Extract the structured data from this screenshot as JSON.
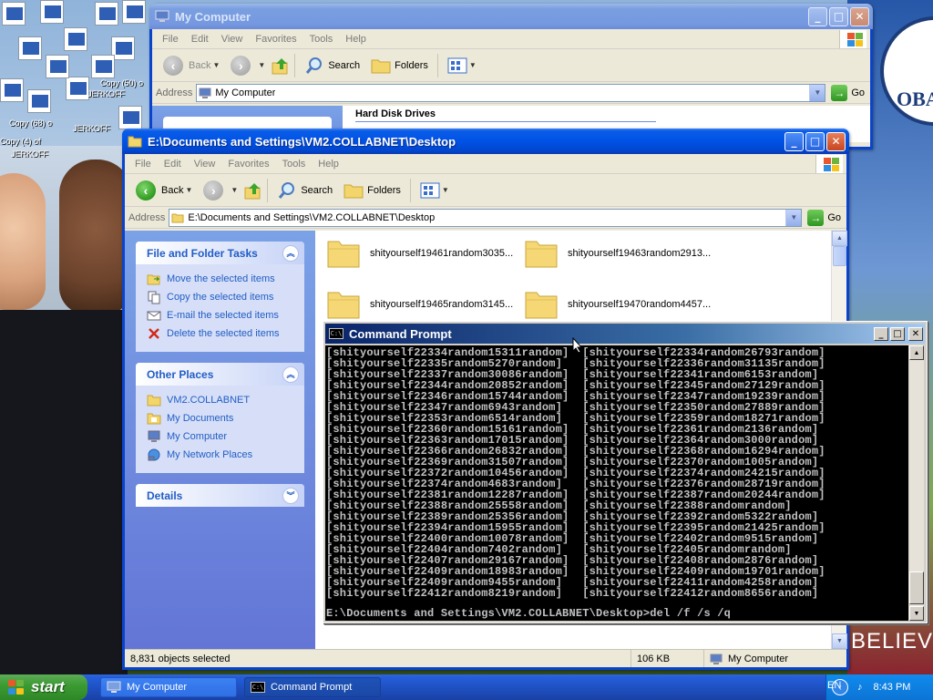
{
  "desktop": {
    "icon_labels": [
      "Copy (50) o",
      "Copy (4) of",
      "JERKOFF",
      "JERKOFF",
      "Copy (68) o",
      "JERKOFF"
    ],
    "wallpaper_text": "BELIEVE",
    "logo_text": "OBA"
  },
  "back_window": {
    "title": "My Computer",
    "menu": [
      "File",
      "Edit",
      "View",
      "Favorites",
      "Tools",
      "Help"
    ],
    "toolbar": {
      "back": "Back",
      "search": "Search",
      "folders": "Folders"
    },
    "address_label": "Address",
    "address_value": "My Computer",
    "go_label": "Go",
    "section_header": "Hard Disk Drives"
  },
  "explorer": {
    "title": "E:\\Documents and Settings\\VM2.COLLABNET\\Desktop",
    "menu": [
      "File",
      "Edit",
      "View",
      "Favorites",
      "Tools",
      "Help"
    ],
    "toolbar": {
      "back": "Back",
      "search": "Search",
      "folders": "Folders"
    },
    "address_label": "Address",
    "address_value": "E:\\Documents and Settings\\VM2.COLLABNET\\Desktop",
    "go_label": "Go",
    "file_folder_tasks": {
      "header": "File and Folder Tasks",
      "items": [
        "Move the selected items",
        "Copy the selected items",
        "E-mail the selected items",
        "Delete the selected items"
      ]
    },
    "other_places": {
      "header": "Other Places",
      "items": [
        "VM2.COLLABNET",
        "My Documents",
        "My Computer",
        "My Network Places"
      ]
    },
    "details": {
      "header": "Details"
    },
    "folders": [
      "shityourself19461random3035...",
      "shityourself19463random2913...",
      "shityourself19465random3145...",
      "shityourself19470random4457..."
    ],
    "status": {
      "objects": "8,831 objects selected",
      "size": "106 KB",
      "location": "My Computer"
    }
  },
  "cmd": {
    "title": "Command Prompt",
    "lines": [
      "[shityourself22334random15311random]  [shityourself22334random26793random]",
      "[shityourself22335random5270random]   [shityourself22336random31135random]",
      "[shityourself22337random30086random]  [shityourself22341random6153random]",
      "[shityourself22344random20852random]  [shityourself22345random27129random]",
      "[shityourself22346random15744random]  [shityourself22347random19239random]",
      "[shityourself22347random6943random]   [shityourself22350random27889random]",
      "[shityourself22353random6514random]   [shityourself22359random18271random]",
      "[shityourself22360random15161random]  [shityourself22361random2136random]",
      "[shityourself22363random17015random]  [shityourself22364random3000random]",
      "[shityourself22366random26832random]  [shityourself22368random16294random]",
      "[shityourself22369random31507random]  [shityourself22370random1005random]",
      "[shityourself22372random10456random]  [shityourself22374random24215random]",
      "[shityourself22374random4683random]   [shityourself22376random28719random]",
      "[shityourself22381random12287random]  [shityourself22387random20244random]",
      "[shityourself22388random25558random]  [shityourself22388randomrandom]",
      "[shityourself22389random25356random]  [shityourself22392random5322random]",
      "[shityourself22394random15955random]  [shityourself22395random21425random]",
      "[shityourself22400random10078random]  [shityourself22402random9515random]",
      "[shityourself22404random7402random]   [shityourself22405randomrandom]",
      "[shityourself22407random29167random]  [shityourself22408random2876random]",
      "[shityourself22409random18983random]  [shityourself22409random19701random]",
      "[shityourself22409random9455random]   [shityourself22411random4258random]",
      "[shityourself22412random8219random]   [shityourself22412random8656random]"
    ],
    "prompt": "E:\\Documents and Settings\\VM2.COLLABNET\\Desktop>del /f /s /q"
  },
  "taskbar": {
    "start_label": "start",
    "buttons": [
      "My Computer",
      "Command Prompt"
    ],
    "lang": "EN",
    "clock": "8:43 PM"
  }
}
